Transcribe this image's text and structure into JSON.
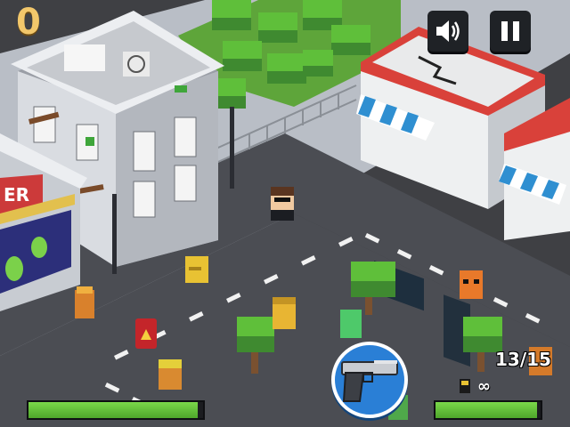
{
  "hud": {
    "score": "0",
    "ammo_text": "13/15",
    "reserve_symbol": "∞",
    "health_level": 0.97,
    "weapon_reload_level": 0.97,
    "sound_icon": "speaker-icon",
    "pause_icon": "pause-icon",
    "weapon_icon": "pistol-icon"
  },
  "scene": {
    "storefront_sign": "ER"
  },
  "colors": {
    "accent_green": "#5fbf3a",
    "score_gold": "#f2c76b",
    "weapon_blue": "#2a7fd6",
    "roof_red": "#d9413a"
  }
}
